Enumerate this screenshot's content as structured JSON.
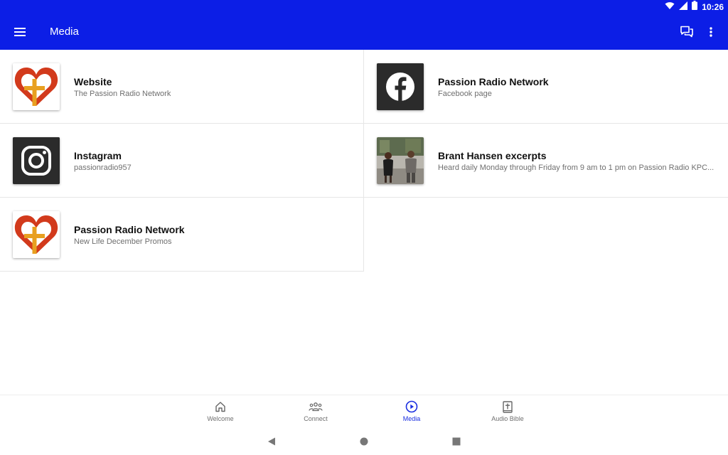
{
  "status_bar": {
    "time": "10:26",
    "icons": [
      "wifi-icon",
      "signal-icon",
      "battery-icon"
    ]
  },
  "app_bar": {
    "title": "Media",
    "icons": [
      "menu-icon",
      "chat-icon",
      "more-vert-icon"
    ]
  },
  "colors": {
    "primary": "#0c1ee6",
    "active_nav": "#1a2ee0",
    "subtitle": "#6f6f6f"
  },
  "media_items": [
    {
      "title": "Website",
      "subtitle": "The Passion Radio Network",
      "thumbnail": "passion-radio-logo"
    },
    {
      "title": "Passion Radio Network",
      "subtitle": "Facebook page",
      "thumbnail": "facebook-icon"
    },
    {
      "title": "Instagram",
      "subtitle": "passionradio957",
      "thumbnail": "instagram-icon"
    },
    {
      "title": "Brant Hansen excerpts",
      "subtitle": "Heard daily Monday through Friday from 9 am to 1 pm on Passion Radio KPC...",
      "thumbnail": "brant-hansen-photo"
    },
    {
      "title": "Passion Radio Network",
      "subtitle": "New Life December Promos",
      "thumbnail": "passion-radio-logo"
    }
  ],
  "bottom_nav": {
    "active": "Media",
    "items": [
      {
        "label": "Welcome",
        "icon": "home-icon"
      },
      {
        "label": "Connect",
        "icon": "people-icon"
      },
      {
        "label": "Media",
        "icon": "play-circle-icon"
      },
      {
        "label": "Audio Bible",
        "icon": "bible-icon"
      }
    ]
  },
  "system_nav": [
    "back-icon",
    "home-circle-icon",
    "recents-icon"
  ]
}
